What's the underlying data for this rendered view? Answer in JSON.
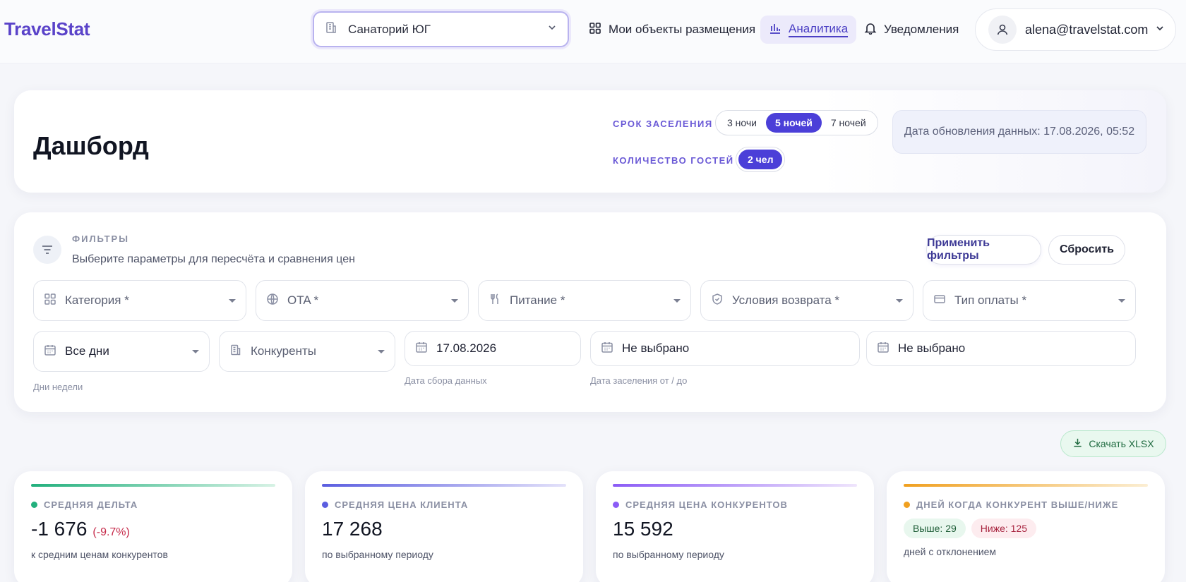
{
  "app": {
    "logo": "TravelStat"
  },
  "topbar": {
    "hotel_selected": "Санаторий ЮГ",
    "nav": [
      {
        "label": "Мои объекты размещения",
        "icon": "grid-icon"
      },
      {
        "label": "Аналитика",
        "icon": "bar-chart-icon",
        "active": true
      },
      {
        "label": "Уведомления",
        "icon": "bell-icon"
      }
    ],
    "user_email": "alena@travelstat.com"
  },
  "header": {
    "title": "Дашборд",
    "stay_caption": "СРОК ЗАСЕЛЕНИЯ",
    "stay_options": [
      "3 ночи",
      "5 ночей",
      "7 ночей"
    ],
    "stay_selected": "5 ночей",
    "guests_caption": "КОЛИЧЕСТВО ГОСТЕЙ",
    "guests_options": [
      "2 чел"
    ],
    "guests_selected": "2 чел",
    "update_text": "Дата обновления данных: 17.08.2026, 05:52"
  },
  "filters": {
    "title": "ФИЛЬТРЫ",
    "subtitle": "Выберите параметры для пересчёта и сравнения цен",
    "apply_label": "Применить фильтры",
    "reset_label": "Сбросить",
    "row1": [
      {
        "label": "Категория *",
        "icon": "category-grid-icon"
      },
      {
        "label": "OTA *",
        "icon": "globe-icon"
      },
      {
        "label": "Питание *",
        "icon": "utensils-icon"
      },
      {
        "label": "Условия возврата *",
        "icon": "shield-icon"
      },
      {
        "label": "Тип оплаты *",
        "icon": "credit-card-icon"
      }
    ],
    "weekdays_value": "Все дни",
    "weekdays_hint": "Дни недели",
    "competitors_label": "Конкуренты",
    "collect_date_value": "17.08.2026",
    "collect_date_hint": "Дата сбора данных",
    "checkin_from_value": "Не выбрано",
    "checkin_to_value": "Не выбрано",
    "checkin_hint": "Дата заселения от / до"
  },
  "download": {
    "label": "Скачать XLSX"
  },
  "kpis": [
    {
      "label": "СРЕДНЯЯ ДЕЛЬТА",
      "value": "-1 676",
      "delta": "(-9.7%)",
      "sub": "к средним ценам конкурентов",
      "dot": "#22b07d"
    },
    {
      "label": "СРЕДНЯЯ ЦЕНА КЛИЕНТА",
      "value": "17 268",
      "sub": "по выбранному периоду",
      "dot": "#5b5ee0"
    },
    {
      "label": "СРЕДНЯЯ ЦЕНА КОНКУРЕНТОВ",
      "value": "15 592",
      "sub": "по выбранному периоду",
      "dot": "#8b5cf6"
    },
    {
      "label": "ДНЕЙ КОГДА КОНКУРЕНТ ВЫШЕ/НИЖЕ",
      "above": "Выше: 29",
      "below": "Ниже: 125",
      "sub": "дней с отклонением",
      "dot": "#f0a020"
    }
  ],
  "colors": {
    "accent": "#4b3fd8",
    "brand": "#5a43c9",
    "positive": "#22b07d",
    "negative": "#c62a4a"
  }
}
